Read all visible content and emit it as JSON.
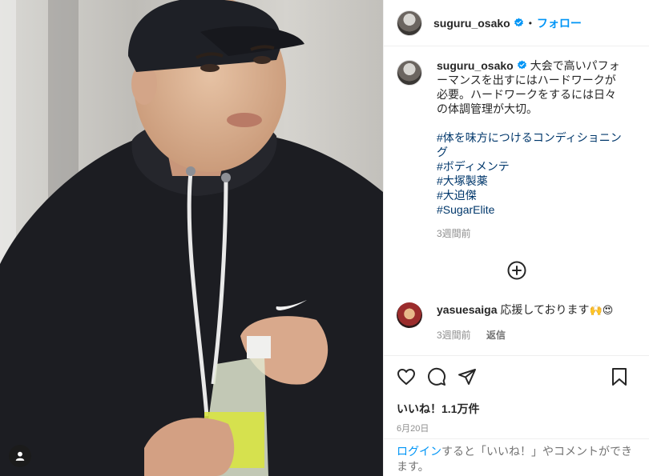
{
  "post": {
    "username": "suguru_osako",
    "follow_label": "フォロー",
    "separator": "•",
    "caption_lines": [
      "大会で高いパフォーマンスを出すにはハードワークが必要。ハードワークをするには日々の体調管理が大切。"
    ],
    "hashtags": [
      "#体を味方につけるコンディショニング",
      "#ボディメンテ",
      "#大塚製薬",
      "#大迫傑",
      "#SugarElite"
    ],
    "caption_time": "3週間前"
  },
  "comments": [
    {
      "username": "yasuesaiga",
      "text": "応援しております",
      "emoji": "🙌😍",
      "time": "3週間前",
      "reply_label": "返信"
    }
  ],
  "footer": {
    "likes": "いいね！1.1万件",
    "date": "6月20日",
    "login_link": "ログイン",
    "login_text": "すると「いいね！」やコメントができます。"
  },
  "colors": {
    "accent": "#0095f6",
    "hashtag": "#00376b",
    "muted": "#8e8e8e"
  },
  "icons": [
    "verified-badge-icon",
    "add-circle-icon",
    "heart-icon",
    "comment-icon",
    "share-icon",
    "bookmark-icon",
    "user-tag-icon"
  ]
}
